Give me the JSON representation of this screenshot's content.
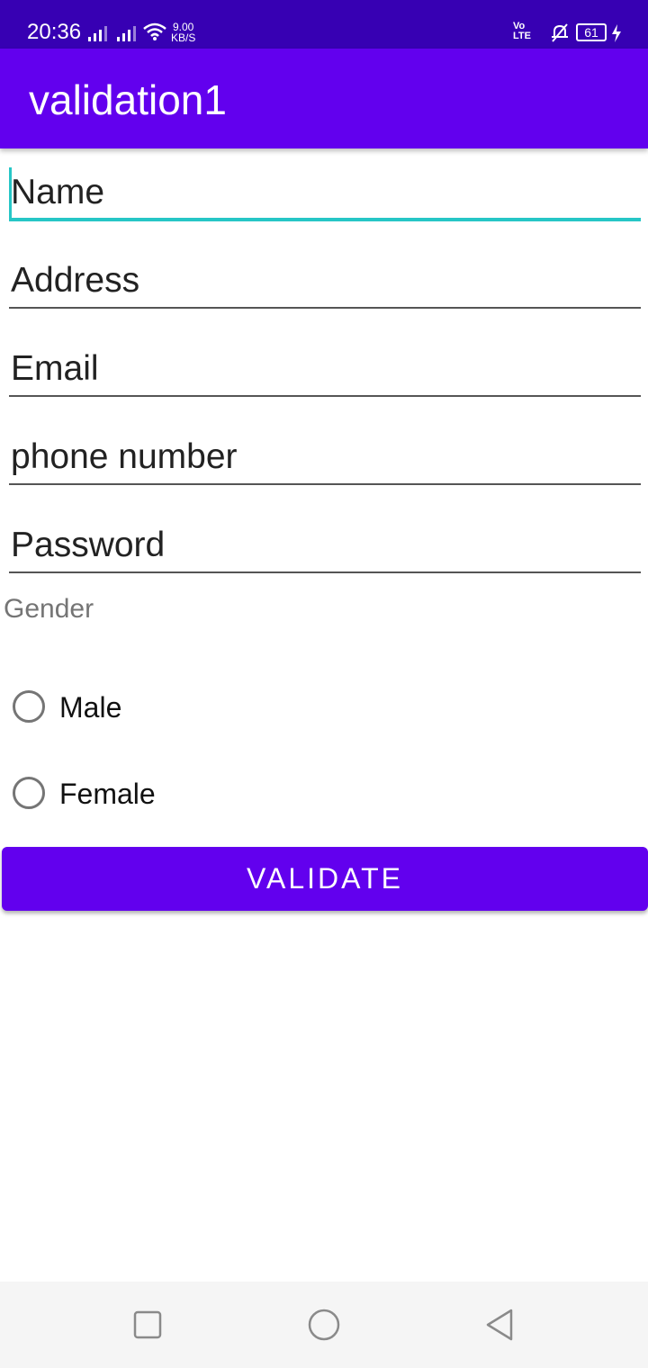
{
  "status_bar": {
    "time": "20:36",
    "speed_value": "9.00",
    "speed_unit": "KB/S",
    "volte_top": "Vo",
    "volte_bottom": "LTE",
    "battery": "61",
    "icons": [
      "signal-icon",
      "signal-icon",
      "wifi-icon",
      "bell-off-icon",
      "battery-icon",
      "charging-icon"
    ]
  },
  "app_bar": {
    "title": "validation1"
  },
  "form": {
    "name_placeholder": "Name",
    "address_placeholder": "Address",
    "email_placeholder": "Email",
    "phone_placeholder": "phone number",
    "password_placeholder": "Password",
    "gender_label": "Gender",
    "gender_options": [
      "Male",
      "Female"
    ],
    "validate_label": "VALIDATE"
  },
  "nav_bar": {
    "icons": [
      "recent-apps-icon",
      "home-icon",
      "back-icon"
    ]
  },
  "colors": {
    "status_bar": "#3700b3",
    "primary": "#6200ee",
    "accent": "#26c6c6"
  }
}
